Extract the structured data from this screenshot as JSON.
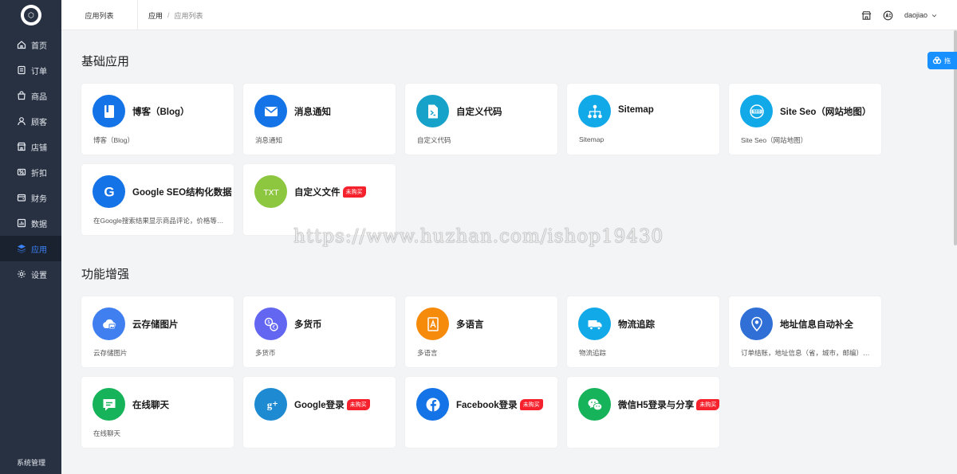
{
  "sidebar": {
    "items": [
      {
        "label": "首页",
        "icon": "home-icon"
      },
      {
        "label": "订单",
        "icon": "order-icon"
      },
      {
        "label": "商品",
        "icon": "bag-icon"
      },
      {
        "label": "顾客",
        "icon": "user-icon"
      },
      {
        "label": "店铺",
        "icon": "store-icon"
      },
      {
        "label": "折扣",
        "icon": "discount-icon"
      },
      {
        "label": "财务",
        "icon": "finance-icon"
      },
      {
        "label": "数据",
        "icon": "data-icon"
      },
      {
        "label": "应用",
        "icon": "apps-icon"
      },
      {
        "label": "设置",
        "icon": "gear-icon"
      }
    ],
    "active_index": 8,
    "system_label": "系统管理"
  },
  "header": {
    "tab": "应用列表",
    "breadcrumb": {
      "root": "应用",
      "sep": "/",
      "current": "应用列表"
    },
    "username": "daojiao"
  },
  "float_widget": {
    "label": "拖"
  },
  "watermark": "https://www.huzhan.com/ishop19430",
  "badge_text": "未购买",
  "sections": [
    {
      "title": "基础应用",
      "cards": [
        {
          "title": "博客（Blog）",
          "desc": "博客（Blog）",
          "color": "#1473e6",
          "icon": "blog-icon",
          "badge": false
        },
        {
          "title": "消息通知",
          "desc": "消息通知",
          "color": "#1473e6",
          "icon": "mail-icon",
          "badge": false
        },
        {
          "title": "自定义代码",
          "desc": "自定义代码",
          "color": "#17a2c9",
          "icon": "code-file-icon",
          "badge": false
        },
        {
          "title": "Sitemap",
          "desc": "Sitemap",
          "color": "#12a9e8",
          "icon": "sitemap-icon",
          "badge": false
        },
        {
          "title": "Site Seo（网站地图）",
          "desc": "Site Seo（网站地图）",
          "color": "#12a9e8",
          "icon": "seo-icon",
          "badge": false
        },
        {
          "title": "Google SEO结构化数据",
          "desc": "在Google搜索结果显示商品评论，价格等信息",
          "color": "#1473e6",
          "icon": "google-icon",
          "badge": false
        },
        {
          "title": "自定义文件",
          "desc": "",
          "color": "#8dc63f",
          "icon": "txt-icon",
          "badge": true
        }
      ]
    },
    {
      "title": "功能增强",
      "cards": [
        {
          "title": "云存储图片",
          "desc": "云存储图片",
          "color": "#3f7ff0",
          "icon": "cloud-image-icon",
          "badge": false
        },
        {
          "title": "多货币",
          "desc": "多货币",
          "color": "#6366f1",
          "icon": "currency-icon",
          "badge": false
        },
        {
          "title": "多语言",
          "desc": "多语言",
          "color": "#f58a0b",
          "icon": "language-icon",
          "badge": false
        },
        {
          "title": "物流追踪",
          "desc": "物流追踪",
          "color": "#12a9e8",
          "icon": "truck-icon",
          "badge": false
        },
        {
          "title": "地址信息自动补全",
          "desc": "订单结账，地址信息（省，城市，邮编）自动补全",
          "color": "#2f6fd6",
          "icon": "location-icon",
          "badge": false
        },
        {
          "title": "在线聊天",
          "desc": "在线聊天",
          "color": "#16b35a",
          "icon": "chat-icon",
          "badge": false
        },
        {
          "title": "Google登录",
          "desc": "",
          "color": "#1d8ad1",
          "icon": "google-plus-icon",
          "badge": true
        },
        {
          "title": "Facebook登录",
          "desc": "",
          "color": "#1473e6",
          "icon": "facebook-icon",
          "badge": true
        },
        {
          "title": "微信H5登录与分享",
          "desc": "",
          "color": "#16b35a",
          "icon": "wechat-icon",
          "badge": true
        }
      ]
    }
  ]
}
